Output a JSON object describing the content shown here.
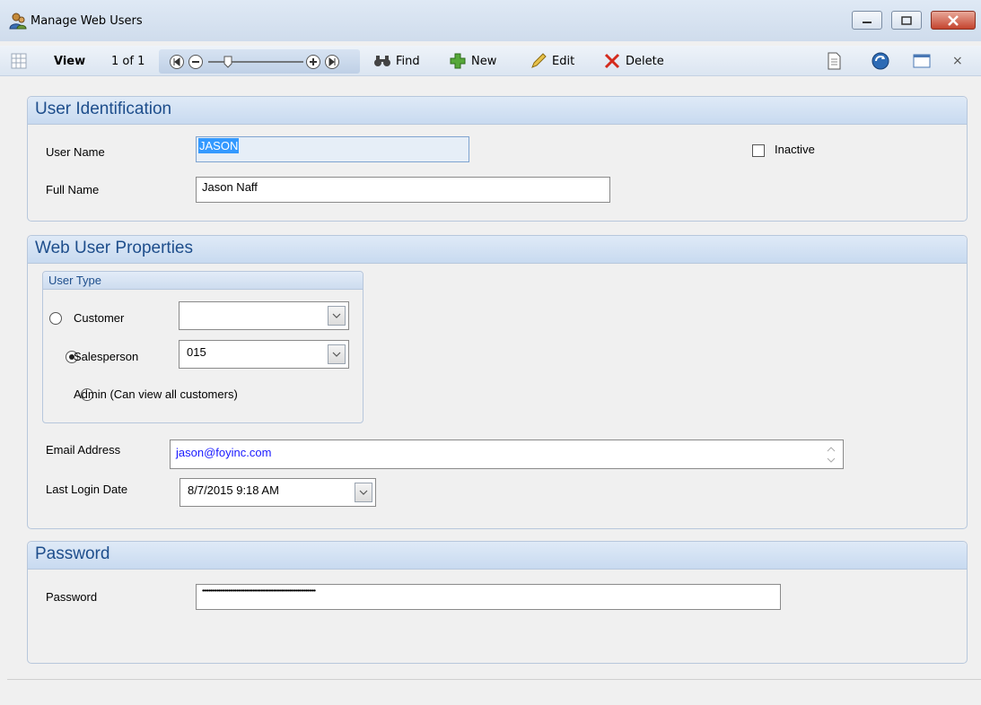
{
  "window": {
    "title": "Manage Web Users",
    "icon": "user-icon"
  },
  "toolbar": {
    "view_label": "View",
    "record_position": "1 of 1",
    "find_label": "Find",
    "new_label": "New",
    "edit_label": "Edit",
    "delete_label": "Delete",
    "close_glyph": "×"
  },
  "user_identification": {
    "header": "User Identification",
    "user_name_label": "User Name",
    "user_name_value": "JASON",
    "full_name_label": "Full Name",
    "full_name_value": "Jason Naff",
    "inactive_label": "Inactive",
    "inactive_checked": false
  },
  "web_user_properties": {
    "header": "Web User Properties",
    "user_type": {
      "header": "User Type",
      "customer_label": "Customer",
      "customer_value": "",
      "salesperson_label": "Salesperson",
      "salesperson_value": "015",
      "admin_label": "Admin (Can view all customers)",
      "selected": "salesperson"
    },
    "email_label": "Email Address",
    "email_value": "jason@foyinc.com",
    "last_login_label": "Last Login Date",
    "last_login_value": "8/7/2015 9:18 AM"
  },
  "password_section": {
    "header": "Password",
    "password_label": "Password",
    "password_value": "••••••••••••••••••••••••••••••••••••••••••••••••••••••••••••••••••••••"
  },
  "colors": {
    "header_text": "#1e4e8c",
    "selection": "#3399ff",
    "email_text": "#1a1aff"
  }
}
